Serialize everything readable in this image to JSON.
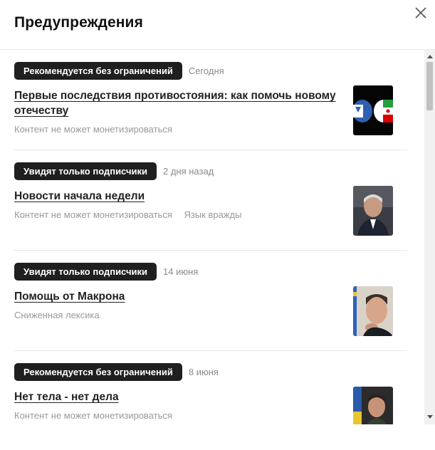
{
  "modal": {
    "title": "Предупреждения",
    "close_icon": "close-icon"
  },
  "warnings": [
    {
      "status": "Рекомендуется без ограничений",
      "date": "Сегодня",
      "title": "Первые последствия противостояния: как помочь новому отечеству",
      "tags": [
        "Контент не может монетизироваться"
      ],
      "thumbnail": "fists-flags-thumbnail"
    },
    {
      "status": "Увидят только подписчики",
      "date": "2 дня назад",
      "title": "Новости начала недели",
      "tags": [
        "Контент не может монетизироваться",
        "Язык вражды"
      ],
      "thumbnail": "man-portrait-thumbnail"
    },
    {
      "status": "Увидят только подписчики",
      "date": "14 июня",
      "title": "Помощь от Макрона",
      "tags": [
        "Сниженная лексика"
      ],
      "thumbnail": "man-thinking-thumbnail"
    },
    {
      "status": "Рекомендуется без ограничений",
      "date": "8 июня",
      "title": "Нет тела - нет дела",
      "tags": [
        "Контент не может монетизироваться"
      ],
      "thumbnail": "man-dark-shirt-thumbnail"
    }
  ],
  "colors": {
    "badge_bg": "#1f1f1f",
    "badge_text": "#ffffff",
    "muted_text": "#999999"
  }
}
